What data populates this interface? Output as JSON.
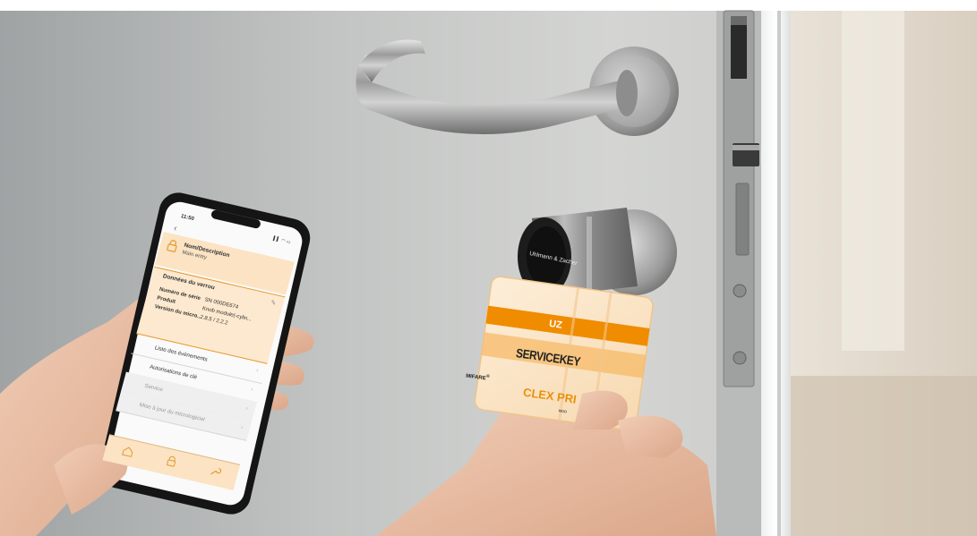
{
  "phone": {
    "status_time": "11:50",
    "status_icons": "▍▍ ◠ ▭",
    "back_glyph": "‹",
    "header_title": "Nom/Description",
    "header_subtitle": "Main entry",
    "section_title": "Données du verrou",
    "details": [
      {
        "label": "Numéro de série",
        "value": "SN 000DE674"
      },
      {
        "label": "Produit",
        "value": "Knob module(-cylin..."
      },
      {
        "label": "Version du micro...",
        "value": "2.8.5 / 2.2.2"
      }
    ],
    "menu": [
      {
        "label": "Liste des événements",
        "enabled": true
      },
      {
        "label": "Autorisations de clé",
        "enabled": true
      },
      {
        "label": "Service",
        "enabled": false
      },
      {
        "label": "Mise à jour du micrologiciel",
        "enabled": false
      }
    ],
    "tabs": [
      "home-icon",
      "lock-icon",
      "wrench-icon"
    ],
    "accent_color": "#e69a2a",
    "panel_color": "#fbe3c3"
  },
  "keycard": {
    "brand_code": "UZ",
    "title": "SERVICEKEY",
    "product": "CLEX PRI",
    "chip": "MIFARE",
    "chip_mark": "®",
    "small_text": "MOD",
    "accent_color": "#f08c00"
  },
  "cylinder": {
    "brand": "Uhlmann & Zacher"
  },
  "icons": [
    "door-handle",
    "knob-cylinder",
    "door-latch",
    "strike-plate",
    "phone",
    "keycard",
    "hand"
  ]
}
